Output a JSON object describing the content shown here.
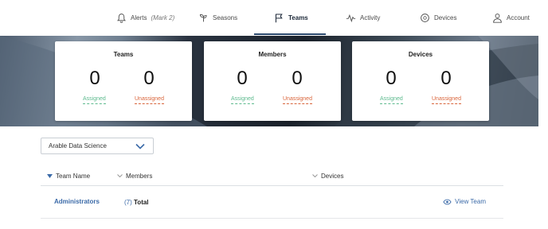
{
  "nav": {
    "items": [
      {
        "label": "Alerts",
        "sub": "(Mark 2)"
      },
      {
        "label": "Seasons"
      },
      {
        "label": "Teams"
      },
      {
        "label": "Activity"
      },
      {
        "label": "Devices"
      },
      {
        "label": "Account"
      }
    ],
    "active": "Teams"
  },
  "cards": [
    {
      "title": "Teams",
      "assigned": "0",
      "unassigned": "0",
      "assigned_label": "Assigned",
      "unassigned_label": "Unassigned"
    },
    {
      "title": "Members",
      "assigned": "0",
      "unassigned": "0",
      "assigned_label": "Assigned",
      "unassigned_label": "Unassigned"
    },
    {
      "title": "Devices",
      "assigned": "0",
      "unassigned": "0",
      "assigned_label": "Assigned",
      "unassigned_label": "Unassigned"
    }
  ],
  "org_select": {
    "value": "Arable Data Science"
  },
  "table": {
    "columns": [
      "Team Name",
      "Members",
      "Devices"
    ],
    "rows": [
      {
        "team": "Administrators",
        "members_count": "(7)",
        "members_label": "Total",
        "action": "View Team"
      }
    ]
  },
  "colors": {
    "assigned": "#5dba8e",
    "unassigned": "#d9653b",
    "link": "#3b6aa8"
  }
}
